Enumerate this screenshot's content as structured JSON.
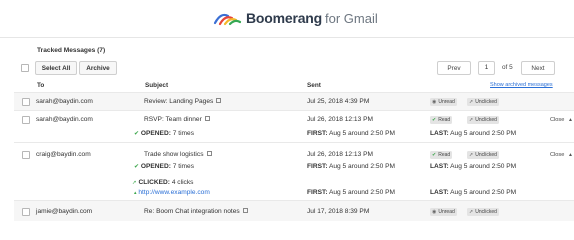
{
  "header": {
    "brand": "Boomerang",
    "suffix": "for Gmail",
    "logo_colors": [
      "#3b6fd4",
      "#e6463a",
      "#f4b82b",
      "#35a853"
    ]
  },
  "list": {
    "title": "Tracked Messages (7)"
  },
  "toolbar": {
    "select_all_label": "Select All",
    "archive_label": "Archive",
    "prev_label": "Prev",
    "page_value": "1",
    "page_of": "of 5",
    "next_label": "Next",
    "show_archived_label": "Show archived messages"
  },
  "columns": {
    "to": "To",
    "subject": "Subject",
    "sent": "Sent"
  },
  "rows": [
    {
      "to": "sarah@baydin.com",
      "subject": "Review: Landing Pages",
      "sent": "Jul 25, 2018 4:39 PM",
      "status_read": "Unread",
      "status_click": "Unclicked"
    },
    {
      "to": "sarah@baydin.com",
      "subject": "RSVP: Team dinner",
      "sent": "Jul 26, 2018 12:13 PM",
      "status_read": "Read",
      "status_click": "Unclicked",
      "close": "Close",
      "opened_label": "OPENED:",
      "opened_value": "7 times",
      "first_label": "FIRST:",
      "first_value": "Aug 5 around 2:50 PM",
      "last_label": "LAST:",
      "last_value": "Aug 5 around 2:50 PM"
    },
    {
      "to": "craig@baydin.com",
      "subject": "Trade show logistics",
      "sent": "Jul 26, 2018 12:13 PM",
      "status_read": "Read",
      "status_click": "Unclicked",
      "close": "Close",
      "opened_label": "OPENED:",
      "opened_value": "7 times",
      "first_label": "FIRST:",
      "first_value": "Aug 5 around 2:50 PM",
      "last_label": "LAST:",
      "last_value": "Aug 5 around 2:50 PM",
      "clicked_label": "CLICKED:",
      "clicked_value": "4 clicks",
      "clicked_url": "http://www.example.com",
      "click_first_label": "FIRST:",
      "click_first_value": "Aug 5 around 2:50 PM",
      "click_last_label": "LAST:",
      "click_last_value": "Aug 5 around 2:50 PM"
    },
    {
      "to": "jamie@baydin.com",
      "subject": "Re: Boom Chat integration notes",
      "sent": "Jul 17, 2018 8:39 PM",
      "status_read": "Unread",
      "status_click": "Unclicked"
    }
  ]
}
